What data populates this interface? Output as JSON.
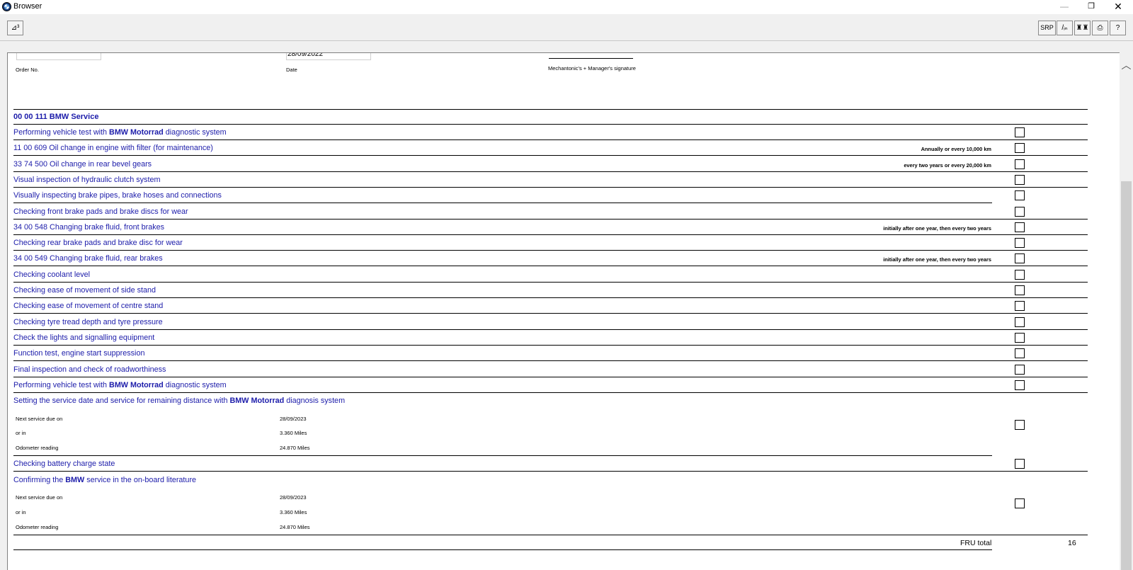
{
  "window": {
    "title": "Browser",
    "minimize_glyph": "—",
    "maximize_glyph": "❐",
    "close_glyph": "✕"
  },
  "toolbar": {
    "left_button_label": "⊿³",
    "srp_label": "SRP",
    "fin_label": "/ᵢₙ",
    "find_label": "♜♜",
    "print_label": "⎙",
    "help_label": "?"
  },
  "header": {
    "order_no_label": "Order No.",
    "order_no_value": "",
    "date_label": "Date",
    "date_value": "28/09/2022",
    "signature_label": "Mechantonic's + Manager's signature"
  },
  "section_title": "00 00 111 BMW Service",
  "items": [
    {
      "pre": "Performing vehicle test with ",
      "bold": "BMW Motorrad",
      "post": " diagnostic system",
      "note": ""
    },
    {
      "pre": "11 00 609 Oil change in engine with filter (for maintenance)",
      "bold": "",
      "post": "",
      "note": "Annually or every 10,000 km"
    },
    {
      "pre": "33 74 500 Oil change in rear bevel gears",
      "bold": "",
      "post": "",
      "note": "every two years or every 20,000 km"
    },
    {
      "pre": "Visual inspection of hydraulic clutch system",
      "bold": "",
      "post": "",
      "note": ""
    },
    {
      "pre": "Visually inspecting brake pipes, brake hoses and connections",
      "bold": "",
      "post": "",
      "note": ""
    },
    {
      "pre": "Checking front brake pads and brake discs for wear",
      "bold": "",
      "post": "",
      "note": ""
    },
    {
      "pre": "34 00 548 Changing brake fluid, front brakes",
      "bold": "",
      "post": "",
      "note": "initially after one year, then every two years"
    },
    {
      "pre": "Checking rear brake pads and brake disc for wear",
      "bold": "",
      "post": "",
      "note": ""
    },
    {
      "pre": "34 00 549 Changing brake fluid, rear brakes",
      "bold": "",
      "post": "",
      "note": "initially after one year, then every two years"
    },
    {
      "pre": "Checking coolant level",
      "bold": "",
      "post": "",
      "note": ""
    },
    {
      "pre": "Checking ease of movement of side stand",
      "bold": "",
      "post": "",
      "note": ""
    },
    {
      "pre": "Checking ease of movement of centre stand",
      "bold": "",
      "post": "",
      "note": ""
    },
    {
      "pre": "Checking tyre tread depth and tyre pressure",
      "bold": "",
      "post": "",
      "note": ""
    },
    {
      "pre": "Check the lights and signalling equipment",
      "bold": "",
      "post": "",
      "note": ""
    },
    {
      "pre": "Function test, engine start suppression",
      "bold": "",
      "post": "",
      "note": ""
    },
    {
      "pre": "Final inspection and check of roadworthiness",
      "bold": "",
      "post": "",
      "note": ""
    },
    {
      "pre": "Performing vehicle test with ",
      "bold": "BMW Motorrad",
      "post": " diagnostic system",
      "note": ""
    }
  ],
  "service_block_1": {
    "pre": "Setting the service date and service for remaining distance with ",
    "bold": "BMW Motorrad",
    "post": " diagnosis system",
    "next_due_label": "Next service due on",
    "next_due_value": "28/09/2023",
    "or_in_label": "or in",
    "or_in_value": "3.360 Miles",
    "odometer_label": "Odometer reading",
    "odometer_value": "24.870 Miles"
  },
  "battery_item": "Checking battery charge state",
  "service_block_2": {
    "pre": "Confirming the ",
    "bold": "BMW",
    "post": " service in the on-board literature",
    "next_due_label": "Next service due on",
    "next_due_value": "28/09/2023",
    "or_in_label": "or in",
    "or_in_value": "3.360 Miles",
    "odometer_label": "Odometer reading",
    "odometer_value": "24.870 Miles"
  },
  "total": {
    "label": "FRU total",
    "value": "16"
  },
  "scrollbar": {
    "up_glyph": "︿"
  }
}
